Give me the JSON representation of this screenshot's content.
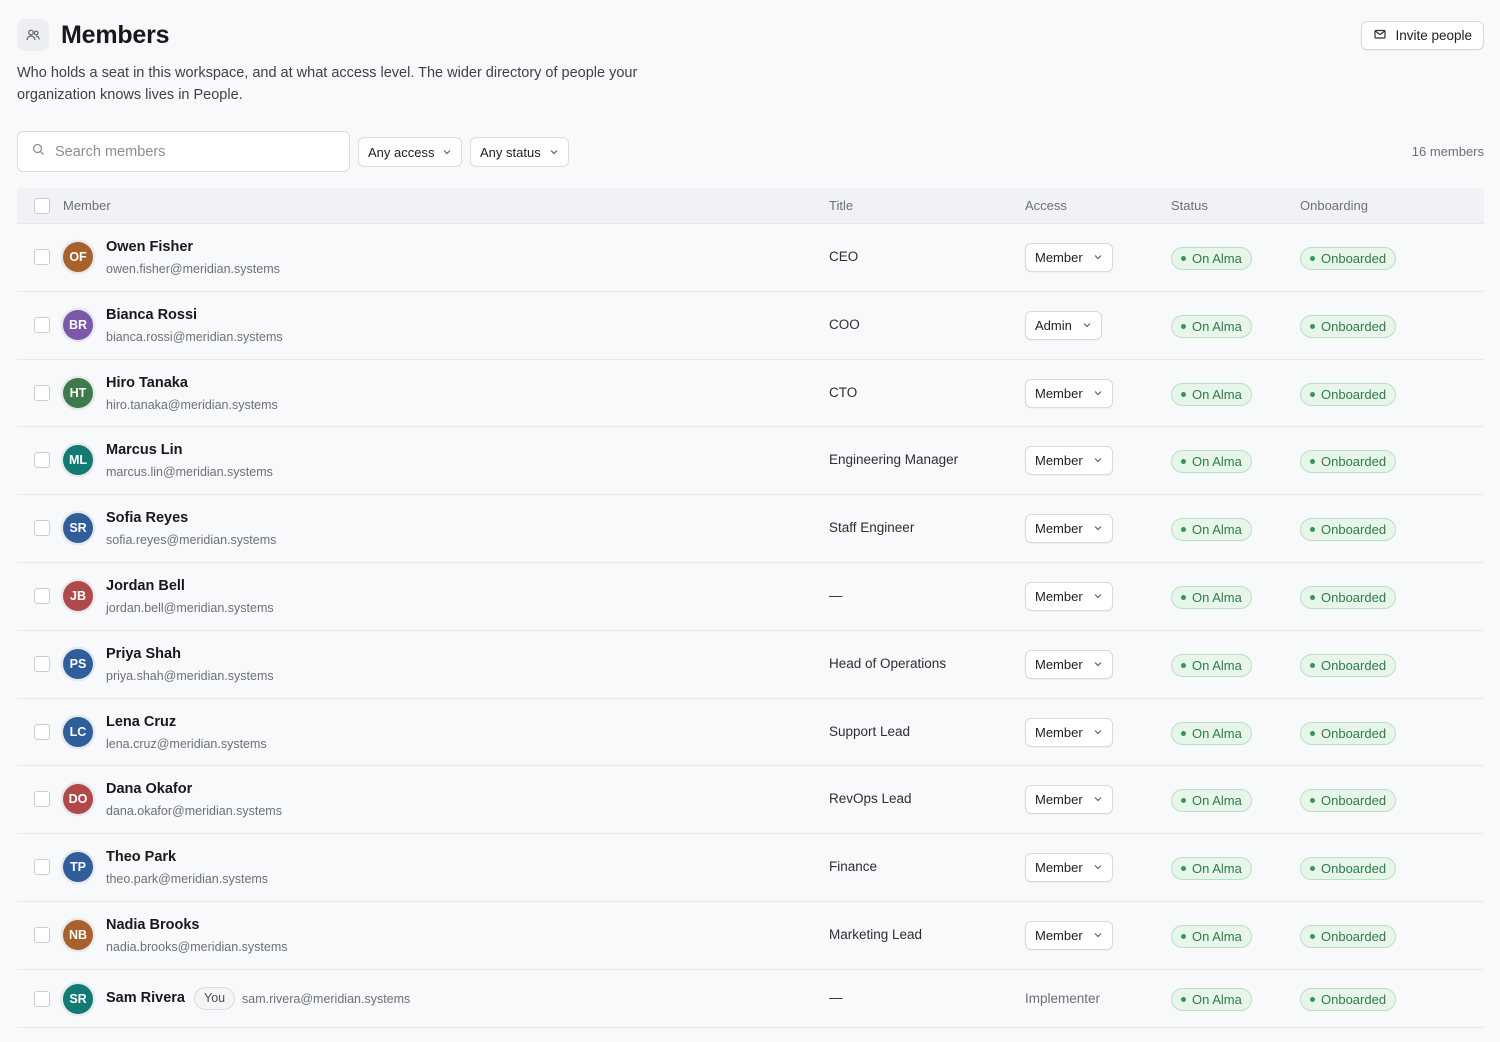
{
  "header": {
    "title": "Members",
    "description": "Who holds a seat in this workspace, and at what access level. The wider directory of people your organization knows lives in People.",
    "invite_label": "Invite people"
  },
  "toolbar": {
    "search_placeholder": "Search members",
    "access_filter": "Any access",
    "status_filter": "Any status",
    "member_count": "16 members"
  },
  "table": {
    "columns": [
      "Member",
      "Title",
      "Access",
      "Status",
      "Onboarding"
    ],
    "rows": [
      {
        "initials": "OF",
        "name": "Owen Fisher",
        "email": "owen.fisher@meridian.systems",
        "title": "CEO",
        "access": "Member",
        "status": "On Alma",
        "onboarding": "Onboarded",
        "avatar_color": "#a8612d"
      },
      {
        "initials": "BR",
        "name": "Bianca Rossi",
        "email": "bianca.rossi@meridian.systems",
        "title": "COO",
        "access": "Admin",
        "status": "On Alma",
        "onboarding": "Onboarded",
        "avatar_color": "#7a5aa8"
      },
      {
        "initials": "HT",
        "name": "Hiro Tanaka",
        "email": "hiro.tanaka@meridian.systems",
        "title": "CTO",
        "access": "Member",
        "status": "On Alma",
        "onboarding": "Onboarded",
        "avatar_color": "#3d7b4a"
      },
      {
        "initials": "ML",
        "name": "Marcus Lin",
        "email": "marcus.lin@meridian.systems",
        "title": "Engineering Manager",
        "access": "Member",
        "status": "On Alma",
        "onboarding": "Onboarded",
        "avatar_color": "#127a72"
      },
      {
        "initials": "SR",
        "name": "Sofia Reyes",
        "email": "sofia.reyes@meridian.systems",
        "title": "Staff Engineer",
        "access": "Member",
        "status": "On Alma",
        "onboarding": "Onboarded",
        "avatar_color": "#2f5e9a"
      },
      {
        "initials": "JB",
        "name": "Jordan Bell",
        "email": "jordan.bell@meridian.systems",
        "title": "—",
        "access": "Member",
        "status": "On Alma",
        "onboarding": "Onboarded",
        "avatar_color": "#b04a4a"
      },
      {
        "initials": "PS",
        "name": "Priya Shah",
        "email": "priya.shah@meridian.systems",
        "title": "Head of Operations",
        "access": "Member",
        "status": "On Alma",
        "onboarding": "Onboarded",
        "avatar_color": "#2f5e9a"
      },
      {
        "initials": "LC",
        "name": "Lena Cruz",
        "email": "lena.cruz@meridian.systems",
        "title": "Support Lead",
        "access": "Member",
        "status": "On Alma",
        "onboarding": "Onboarded",
        "avatar_color": "#2f5e9a"
      },
      {
        "initials": "DO",
        "name": "Dana Okafor",
        "email": "dana.okafor@meridian.systems",
        "title": "RevOps Lead",
        "access": "Member",
        "status": "On Alma",
        "onboarding": "Onboarded",
        "avatar_color": "#b04a4a"
      },
      {
        "initials": "TP",
        "name": "Theo Park",
        "email": "theo.park@meridian.systems",
        "title": "Finance",
        "access": "Member",
        "status": "On Alma",
        "onboarding": "Onboarded",
        "avatar_color": "#2f5e9a"
      },
      {
        "initials": "NB",
        "name": "Nadia Brooks",
        "email": "nadia.brooks@meridian.systems",
        "title": "Marketing Lead",
        "access": "Member",
        "status": "On Alma",
        "onboarding": "Onboarded",
        "avatar_color": "#a8612d"
      }
    ],
    "self_row": {
      "initials": "SR",
      "name": "Sam Rivera",
      "badge": "You",
      "email": "sam.rivera@meridian.systems",
      "title": "—",
      "access": "Implementer",
      "status": "On Alma",
      "onboarding": "Onboarded",
      "avatar_color": "#127a72"
    }
  },
  "icons": {
    "page": "users-icon",
    "invite": "mail-icon",
    "search": "search-icon",
    "dropdown": "chevron-down-icon"
  }
}
